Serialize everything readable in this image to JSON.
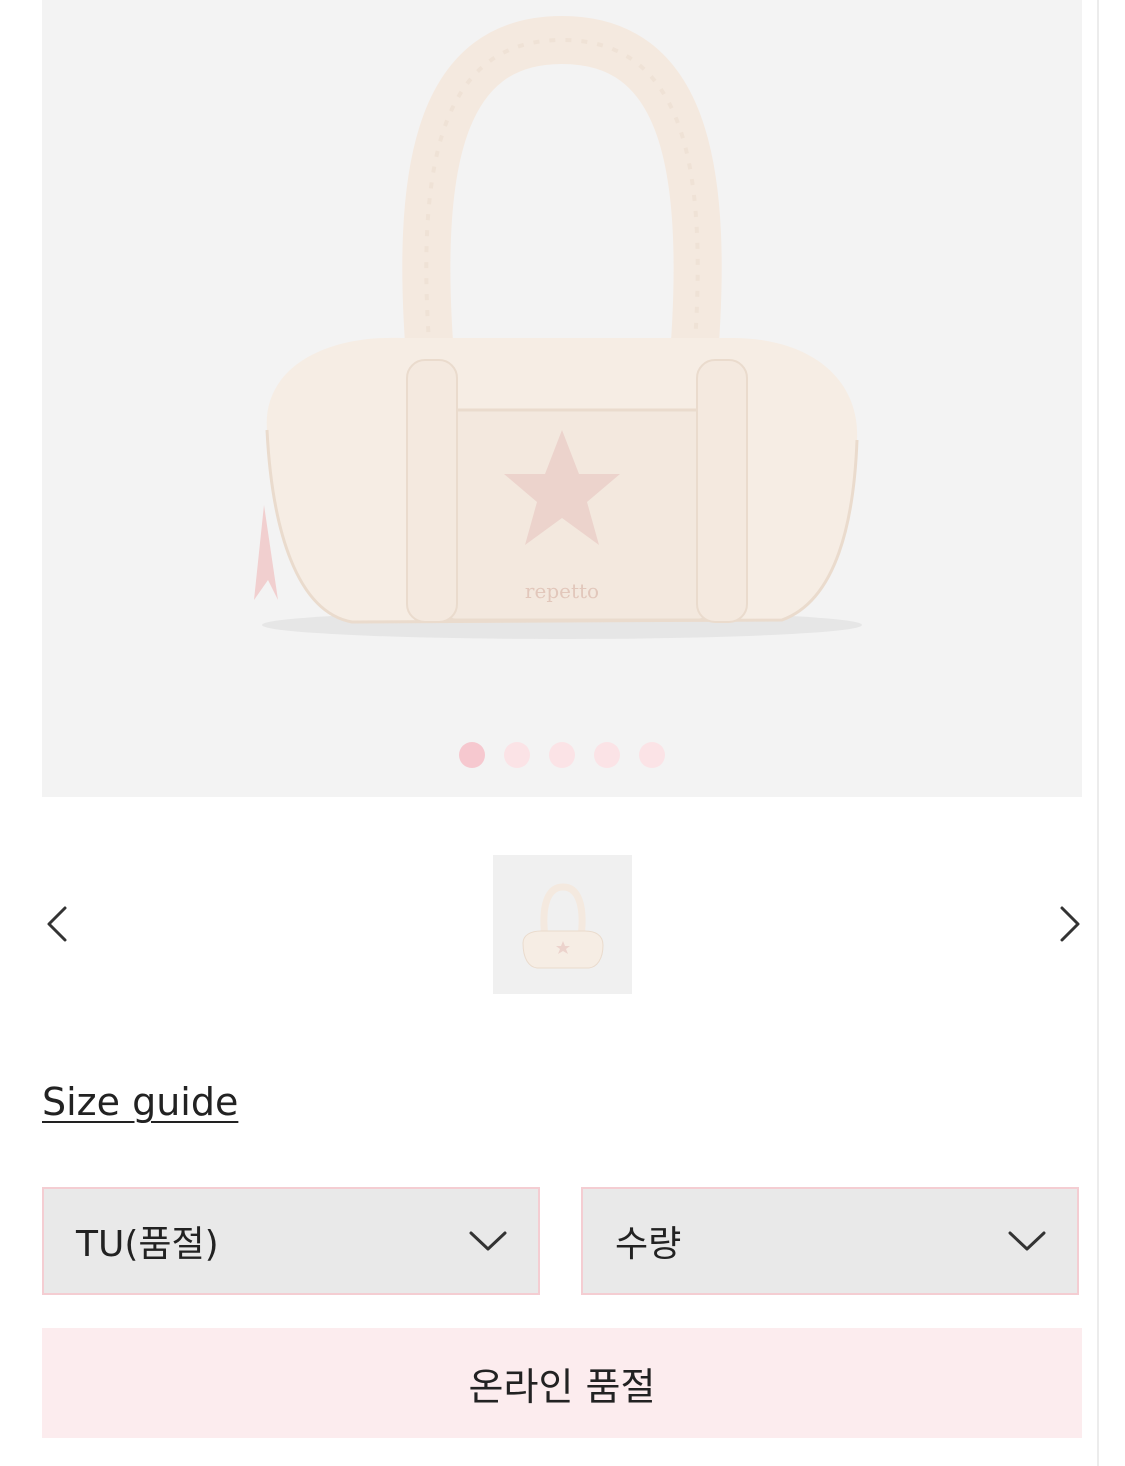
{
  "gallery": {
    "main_image_icon": "duffle-bag-product-image",
    "slide_count": 5,
    "active_slide": 1,
    "prev_icon": "chevron-left-icon",
    "next_icon": "chevron-right-icon",
    "brand_mark_on_bag": "repetto",
    "dot_active_color": "#f6c8cf",
    "dot_color": "#fbe3e6"
  },
  "size_guide": {
    "label": "Size guide"
  },
  "options": {
    "size_select": {
      "selected": "TU(품절)",
      "icon": "chevron-down-icon"
    },
    "quantity_select": {
      "selected": "수량",
      "icon": "chevron-down-icon"
    }
  },
  "cta": {
    "label": "온라인 품절",
    "background": "#fcecee"
  }
}
